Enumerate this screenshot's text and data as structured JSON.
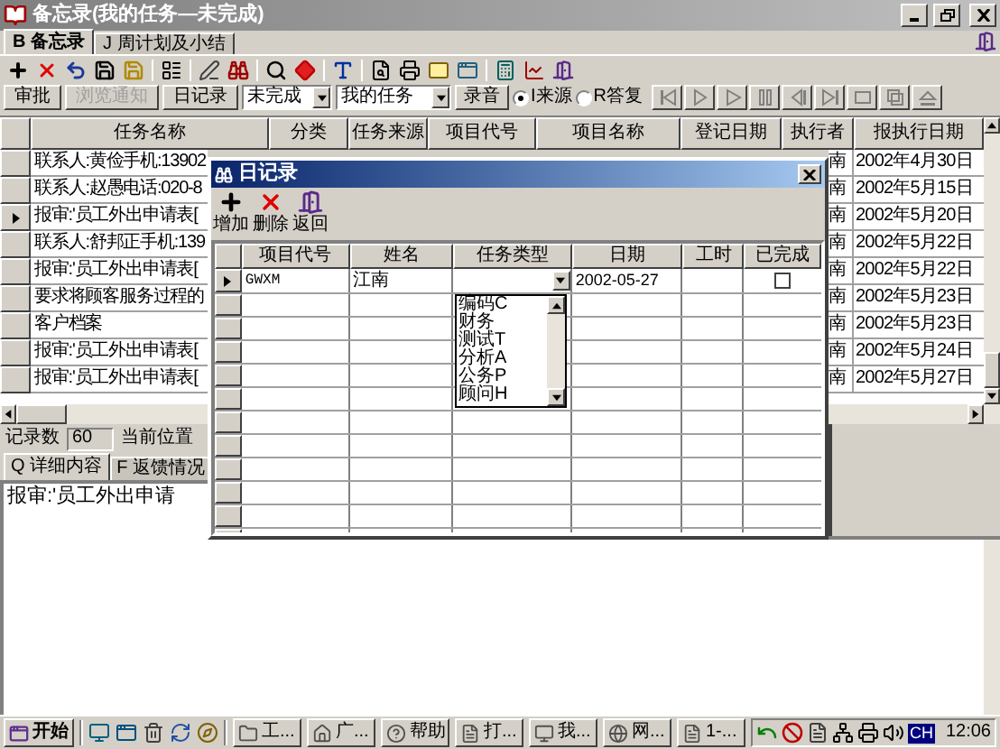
{
  "window": {
    "title": "备忘录(我的任务—未完成)"
  },
  "tabs": [
    {
      "label": "B 备忘录",
      "selected": true
    },
    {
      "label": "J 周计划及小结",
      "selected": false
    }
  ],
  "filter_bar": {
    "buttons": [
      {
        "label": "审批",
        "disabled": false
      },
      {
        "label": "浏览通知",
        "disabled": true
      },
      {
        "label": "日记录",
        "disabled": false
      }
    ],
    "status_select": "未完成",
    "scope_select": "我的任务",
    "record_button": "录音",
    "radios": [
      {
        "label": "I来源",
        "selected": true
      },
      {
        "label": "R答复",
        "selected": false
      }
    ],
    "nav_buttons": [
      {
        "kind": "first",
        "disabled": true
      },
      {
        "kind": "next",
        "disabled": true
      },
      {
        "kind": "play",
        "disabled": true
      },
      {
        "kind": "pause",
        "disabled": true
      },
      {
        "kind": "prev",
        "disabled": true
      },
      {
        "kind": "last",
        "disabled": true
      },
      {
        "kind": "frame",
        "disabled": true
      },
      {
        "kind": "copy",
        "disabled": true
      },
      {
        "kind": "eject",
        "disabled": true
      }
    ]
  },
  "table": {
    "columns": [
      "任务名称",
      "分类",
      "任务来源",
      "项目代号",
      "项目名称",
      "登记日期",
      "执行者",
      "报执行日期"
    ],
    "rows": [
      {
        "task": "联系人:黄俭手机:13902",
        "executor": "南",
        "due": "2002年4月30日",
        "selected": false
      },
      {
        "task": "联系人:赵愚电话:020-8",
        "executor": "南",
        "due": "2002年5月15日",
        "selected": false
      },
      {
        "task": "报审:'员工外出申请表[",
        "executor": "南",
        "due": "2002年5月20日",
        "selected": true
      },
      {
        "task": "联系人:舒邦正手机:139",
        "executor": "南",
        "due": "2002年5月22日",
        "selected": false
      },
      {
        "task": "报审:'员工外出申请表[",
        "executor": "南",
        "due": "2002年5月22日",
        "selected": false
      },
      {
        "task": "要求将顾客服务过程的",
        "executor": "南",
        "due": "2002年5月23日",
        "selected": false
      },
      {
        "task": "客户档案",
        "executor": "南",
        "due": "2002年5月23日",
        "selected": false
      },
      {
        "task": "报审:'员工外出申请表[",
        "executor": "南",
        "due": "2002年5月24日",
        "selected": false
      },
      {
        "task": "报审:'员工外出申请表[",
        "executor": "南",
        "due": "2002年5月27日",
        "selected": false
      }
    ]
  },
  "status": {
    "count_label": "记录数",
    "count": "60",
    "position_label": "当前位置"
  },
  "detail_tabs": [
    {
      "label": "Q 详细内容",
      "selected": true
    },
    {
      "label": "F 返馈情况",
      "selected": false
    }
  ],
  "detail_text": "报审:'员工外出申请",
  "dialog": {
    "title": "日记录",
    "tools": [
      {
        "kind": "add",
        "label": "增加"
      },
      {
        "kind": "delete",
        "label": "删除"
      },
      {
        "kind": "back",
        "label": "返回"
      }
    ],
    "columns": [
      "项目代号",
      "姓名",
      "任务类型",
      "日期",
      "工时",
      "已完成"
    ],
    "rows": [
      {
        "code": "GWXM",
        "name": "江南",
        "date": "2002-05-27",
        "done": false,
        "selected": true
      }
    ],
    "dropdown": {
      "options": [
        "编码C",
        "财务",
        "测试T",
        "分析A",
        "公务P",
        "顾问H"
      ]
    }
  },
  "taskbar": {
    "start": "开始",
    "tasks": [
      "工...",
      "广...",
      "帮助",
      "打...",
      "我...",
      "网...",
      "1-..."
    ],
    "language": "CH",
    "clock": "12:06"
  }
}
